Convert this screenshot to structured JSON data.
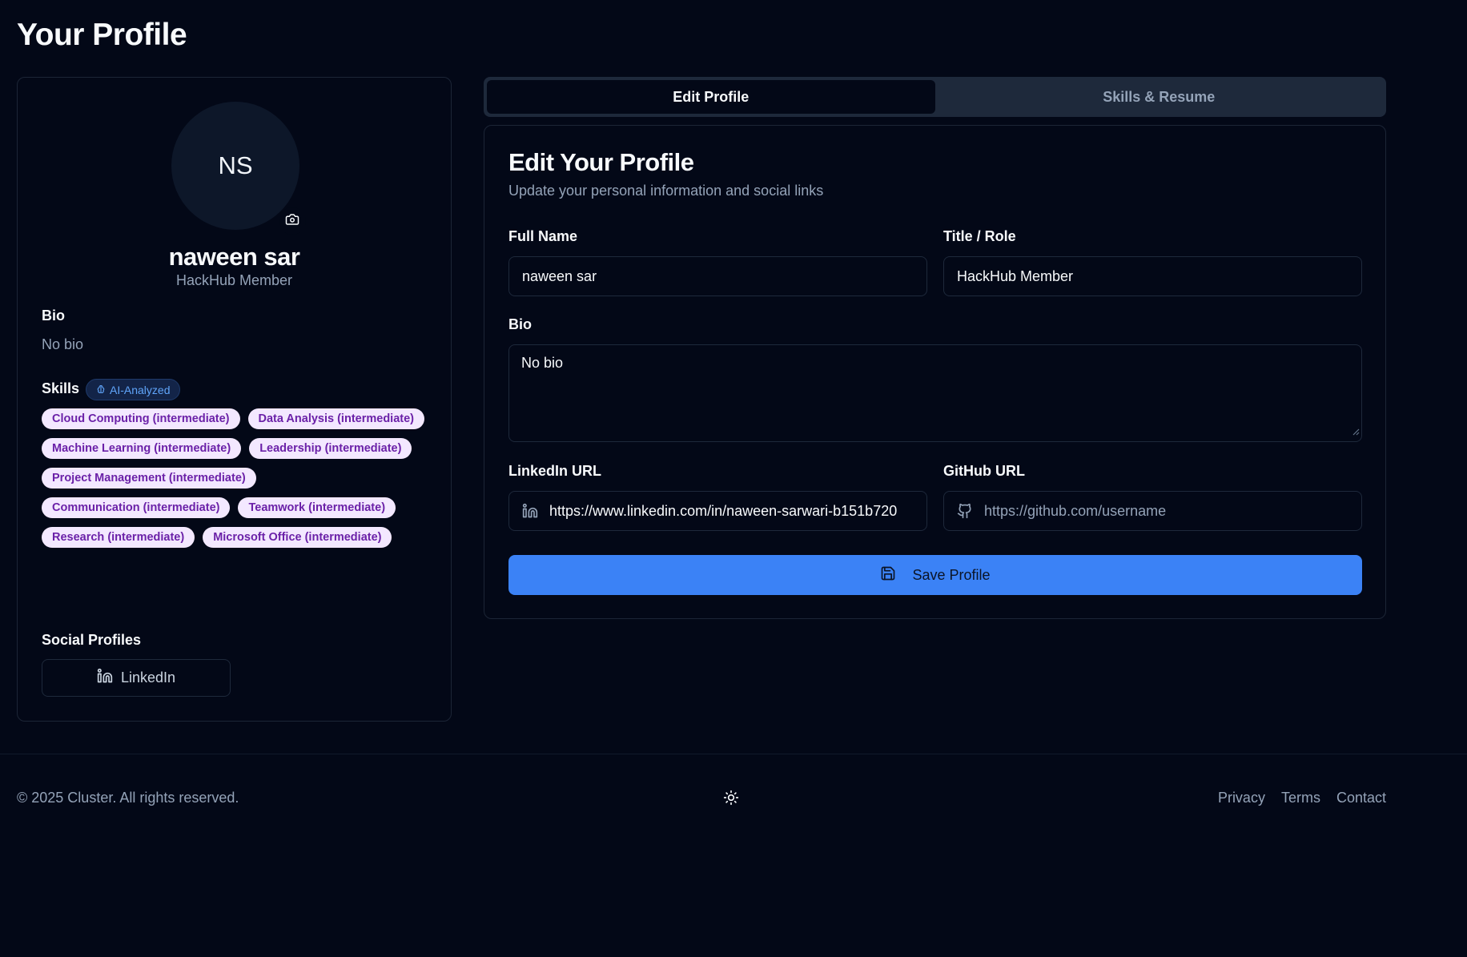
{
  "page": {
    "title": "Your Profile"
  },
  "profile": {
    "initials": "NS",
    "name": "naween sar",
    "role": "HackHub Member",
    "bio_label": "Bio",
    "bio": "No bio",
    "skills_label": "Skills",
    "ai_badge": "AI-Analyzed",
    "skills": [
      "Cloud Computing (intermediate)",
      "Data Analysis (intermediate)",
      "Machine Learning (intermediate)",
      "Leadership (intermediate)",
      "Project Management (intermediate)",
      "Communication (intermediate)",
      "Teamwork (intermediate)",
      "Research (intermediate)",
      "Microsoft Office (intermediate)"
    ],
    "social_label": "Social Profiles",
    "social_linkedin": "LinkedIn"
  },
  "tabs": [
    {
      "label": "Edit Profile",
      "active": true
    },
    {
      "label": "Skills & Resume",
      "active": false
    }
  ],
  "form": {
    "title": "Edit Your Profile",
    "subtitle": "Update your personal information and social links",
    "full_name_label": "Full Name",
    "full_name_value": "naween sar",
    "title_label": "Title / Role",
    "title_value": "HackHub Member",
    "bio_label": "Bio",
    "bio_value": "No bio",
    "linkedin_label": "LinkedIn URL",
    "linkedin_value": "https://www.linkedin.com/in/naween-sarwari-b151b720",
    "github_label": "GitHub URL",
    "github_placeholder": "https://github.com/username",
    "save_label": "Save Profile"
  },
  "footer": {
    "copyright": "© 2025 Cluster. All rights reserved.",
    "links": [
      "Privacy",
      "Terms",
      "Contact"
    ]
  },
  "colors": {
    "background": "#030817",
    "accent": "#3b82f6",
    "skill_chip_bg": "#f3e8ff",
    "skill_chip_text": "#6b21a8"
  },
  "icons": [
    "camera-icon",
    "ai-brain-icon",
    "linkedin-icon",
    "github-icon",
    "save-icon",
    "sun-icon"
  ]
}
